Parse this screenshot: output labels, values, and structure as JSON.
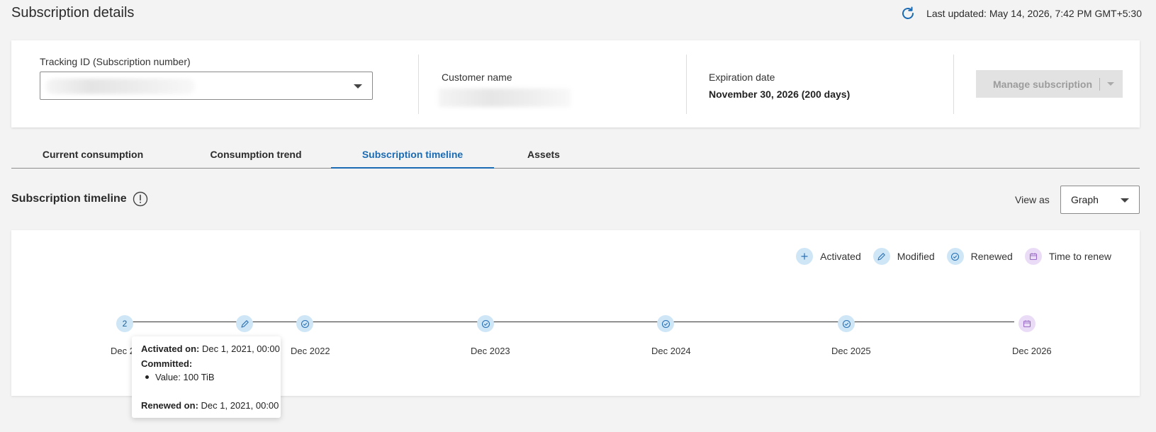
{
  "header": {
    "title": "Subscription details",
    "last_updated": "Last updated: May 14, 2026, 7:42 PM GMT+5:30"
  },
  "info": {
    "tracking_label": "Tracking ID (Subscription number)",
    "customer_label": "Customer name",
    "expiration_label": "Expiration date",
    "expiration_value": "November 30, 2026 (200 days)",
    "manage_button": "Manage subscription"
  },
  "tabs": [
    {
      "label": "Current consumption"
    },
    {
      "label": "Consumption trend"
    },
    {
      "label": "Subscription timeline"
    },
    {
      "label": "Assets"
    }
  ],
  "section": {
    "title": "Subscription timeline",
    "view_as_label": "View as",
    "view_as_value": "Graph"
  },
  "legend": [
    {
      "label": "Activated",
      "icon": "plus-icon",
      "color": "#cfe6f7"
    },
    {
      "label": "Modified",
      "icon": "pencil-icon",
      "color": "#cfe6f7"
    },
    {
      "label": "Renewed",
      "icon": "check-circle-icon",
      "color": "#cfe6f7"
    },
    {
      "label": "Time to renew",
      "icon": "calendar-icon",
      "color": "#eadcf6"
    }
  ],
  "timeline": {
    "group_count": "2",
    "ticks": [
      "Dec 2",
      "Dec 2022",
      "Dec 2023",
      "Dec 2024",
      "Dec 2025",
      "Dec 2026"
    ]
  },
  "tooltip": {
    "activated_label": "Activated on:",
    "activated_value": "Dec 1, 2021, 00:00",
    "committed_label": "Committed:",
    "value_item": "Value: 100 TiB",
    "renewed_label": "Renewed on:",
    "renewed_value": "Dec 1, 2021, 00:00"
  },
  "colors": {
    "accent": "#1a6bb3",
    "marker_blue": "#cfe6f7",
    "marker_purple": "#eadcf6"
  }
}
